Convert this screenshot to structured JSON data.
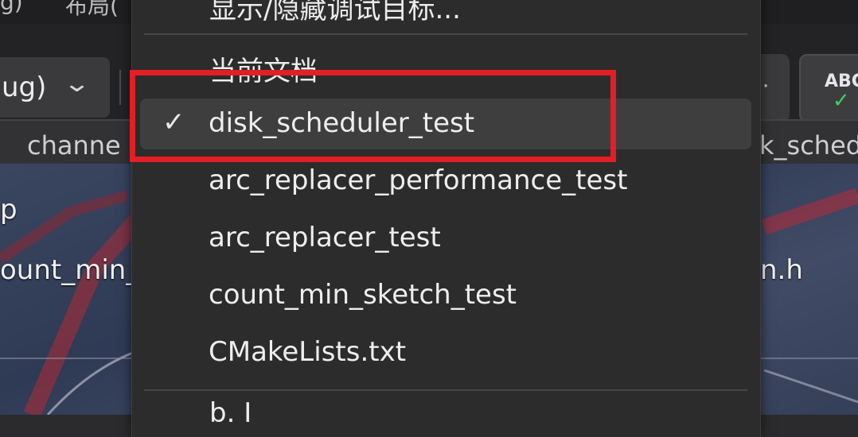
{
  "top_menu": {
    "fragment_left": "g)",
    "fragment_right": "布局("
  },
  "toolbar": {
    "config_combo_text": "ug)",
    "config_chevron_icon": "chevron-down-icon",
    "overflow_icon": "dot-icon",
    "spell_check": {
      "label": "ABC",
      "icon": "check-icon",
      "check_color": "#3ecf5a"
    }
  },
  "tabs": {
    "left": "channe",
    "right": "k_sched"
  },
  "explorer": {
    "items": [
      "p",
      "ount_min_",
      "n.h"
    ]
  },
  "menu": {
    "top_item": "显示/隐藏调试目标...",
    "section": "当前文档",
    "items": [
      {
        "label": "disk_scheduler_test",
        "checked": true
      },
      {
        "label": "arc_replacer_performance_test",
        "checked": false
      },
      {
        "label": "arc_replacer_test",
        "checked": false
      },
      {
        "label": "count_min_sketch_test",
        "checked": false
      },
      {
        "label": "CMakeLists.txt",
        "checked": false
      }
    ],
    "bottom_partial": "b. I"
  },
  "highlight_color": "#e31e24"
}
